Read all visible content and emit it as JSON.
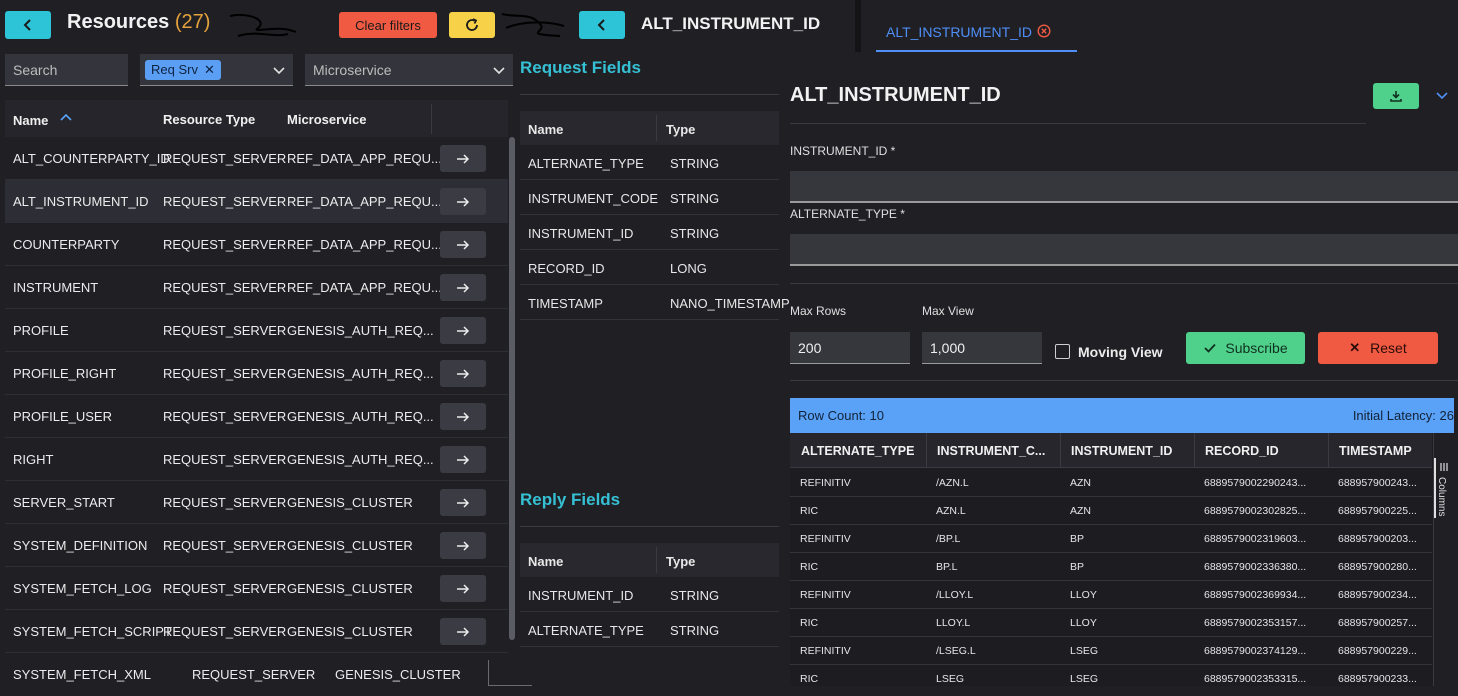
{
  "left_panel": {
    "title": "Resources",
    "count": "(27)",
    "clear_filters": "Clear filters",
    "search_placeholder": "Search",
    "filter_chip": "Req Srv",
    "microservice_placeholder": "Microservice",
    "columns": [
      "Name",
      "Resource Type",
      "Microservice"
    ],
    "rows": [
      {
        "name": "ALT_COUNTERPARTY_ID",
        "type": "REQUEST_SERVER",
        "service": "REF_DATA_APP_REQU..."
      },
      {
        "name": "ALT_INSTRUMENT_ID",
        "type": "REQUEST_SERVER",
        "service": "REF_DATA_APP_REQU..."
      },
      {
        "name": "COUNTERPARTY",
        "type": "REQUEST_SERVER",
        "service": "REF_DATA_APP_REQU..."
      },
      {
        "name": "INSTRUMENT",
        "type": "REQUEST_SERVER",
        "service": "REF_DATA_APP_REQU..."
      },
      {
        "name": "PROFILE",
        "type": "REQUEST_SERVER",
        "service": "GENESIS_AUTH_REQ..."
      },
      {
        "name": "PROFILE_RIGHT",
        "type": "REQUEST_SERVER",
        "service": "GENESIS_AUTH_REQ..."
      },
      {
        "name": "PROFILE_USER",
        "type": "REQUEST_SERVER",
        "service": "GENESIS_AUTH_REQ..."
      },
      {
        "name": "RIGHT",
        "type": "REQUEST_SERVER",
        "service": "GENESIS_AUTH_REQ..."
      },
      {
        "name": "SERVER_START",
        "type": "REQUEST_SERVER",
        "service": "GENESIS_CLUSTER"
      },
      {
        "name": "SYSTEM_DEFINITION",
        "type": "REQUEST_SERVER",
        "service": "GENESIS_CLUSTER"
      },
      {
        "name": "SYSTEM_FETCH_LOG",
        "type": "REQUEST_SERVER",
        "service": "GENESIS_CLUSTER"
      },
      {
        "name": "SYSTEM_FETCH_SCRIPT",
        "type": "REQUEST_SERVER",
        "service": "GENESIS_CLUSTER"
      },
      {
        "name": "SYSTEM_FETCH_XML",
        "type": "REQUEST_SERVER",
        "service": "GENESIS_CLUSTER"
      }
    ]
  },
  "middle_panel": {
    "title": "ALT_INSTRUMENT_ID",
    "request_fields_title": "Request Fields",
    "reply_fields_title": "Reply Fields",
    "columns": [
      "Name",
      "Type"
    ],
    "request_fields": [
      {
        "name": "ALTERNATE_TYPE",
        "type": "STRING"
      },
      {
        "name": "INSTRUMENT_CODE",
        "type": "STRING"
      },
      {
        "name": "INSTRUMENT_ID",
        "type": "STRING"
      },
      {
        "name": "RECORD_ID",
        "type": "LONG"
      },
      {
        "name": "TIMESTAMP",
        "type": "NANO_TIMESTAMP"
      }
    ],
    "reply_fields": [
      {
        "name": "INSTRUMENT_ID",
        "type": "STRING"
      },
      {
        "name": "ALTERNATE_TYPE",
        "type": "STRING"
      }
    ]
  },
  "right_panel": {
    "tab_label": "ALT_INSTRUMENT_ID",
    "title": "ALT_INSTRUMENT_ID",
    "field1_label": "INSTRUMENT_ID *",
    "field2_label": "ALTERNATE_TYPE *",
    "max_rows_label": "Max Rows",
    "max_rows_value": "200",
    "max_view_label": "Max View",
    "max_view_value": "1,000",
    "moving_view_label": "Moving View",
    "subscribe_label": "Subscribe",
    "reset_label": "Reset",
    "row_count": "Row Count: 10",
    "initial_latency": "Initial Latency: 26",
    "columns_side_label": "Columns",
    "grid_columns": [
      "ALTERNATE_TYPE",
      "INSTRUMENT_C...",
      "INSTRUMENT_ID",
      "RECORD_ID",
      "TIMESTAMP"
    ],
    "grid_rows": [
      [
        "REFINITIV",
        "/AZN.L",
        "AZN",
        "6889579002290243...",
        "688957900243..."
      ],
      [
        "RIC",
        "AZN.L",
        "AZN",
        "6889579002302825...",
        "688957900225..."
      ],
      [
        "REFINITIV",
        "/BP.L",
        "BP",
        "6889579002319603...",
        "688957900203..."
      ],
      [
        "RIC",
        "BP.L",
        "BP",
        "6889579002336380...",
        "688957900280..."
      ],
      [
        "REFINITIV",
        "/LLOY.L",
        "LLOY",
        "6889579002369934...",
        "688957900234..."
      ],
      [
        "RIC",
        "LLOY.L",
        "LLOY",
        "6889579002353157...",
        "688957900257..."
      ],
      [
        "REFINITIV",
        "/LSEG.L",
        "LSEG",
        "6889579002374129...",
        "688957900229..."
      ],
      [
        "RIC",
        "LSEG",
        "LSEG",
        "6889579002353315...",
        "688957900233..."
      ]
    ]
  },
  "colors": {
    "accent_cyan": "#2ec4d8",
    "clear_red": "#f05a43",
    "refresh_yellow": "#f7d248",
    "subscribe_green": "#4fd18b",
    "reset_red": "#f05a43",
    "grid_header_blue": "#5aa2f7",
    "tab_blue": "#4f8ff7"
  }
}
